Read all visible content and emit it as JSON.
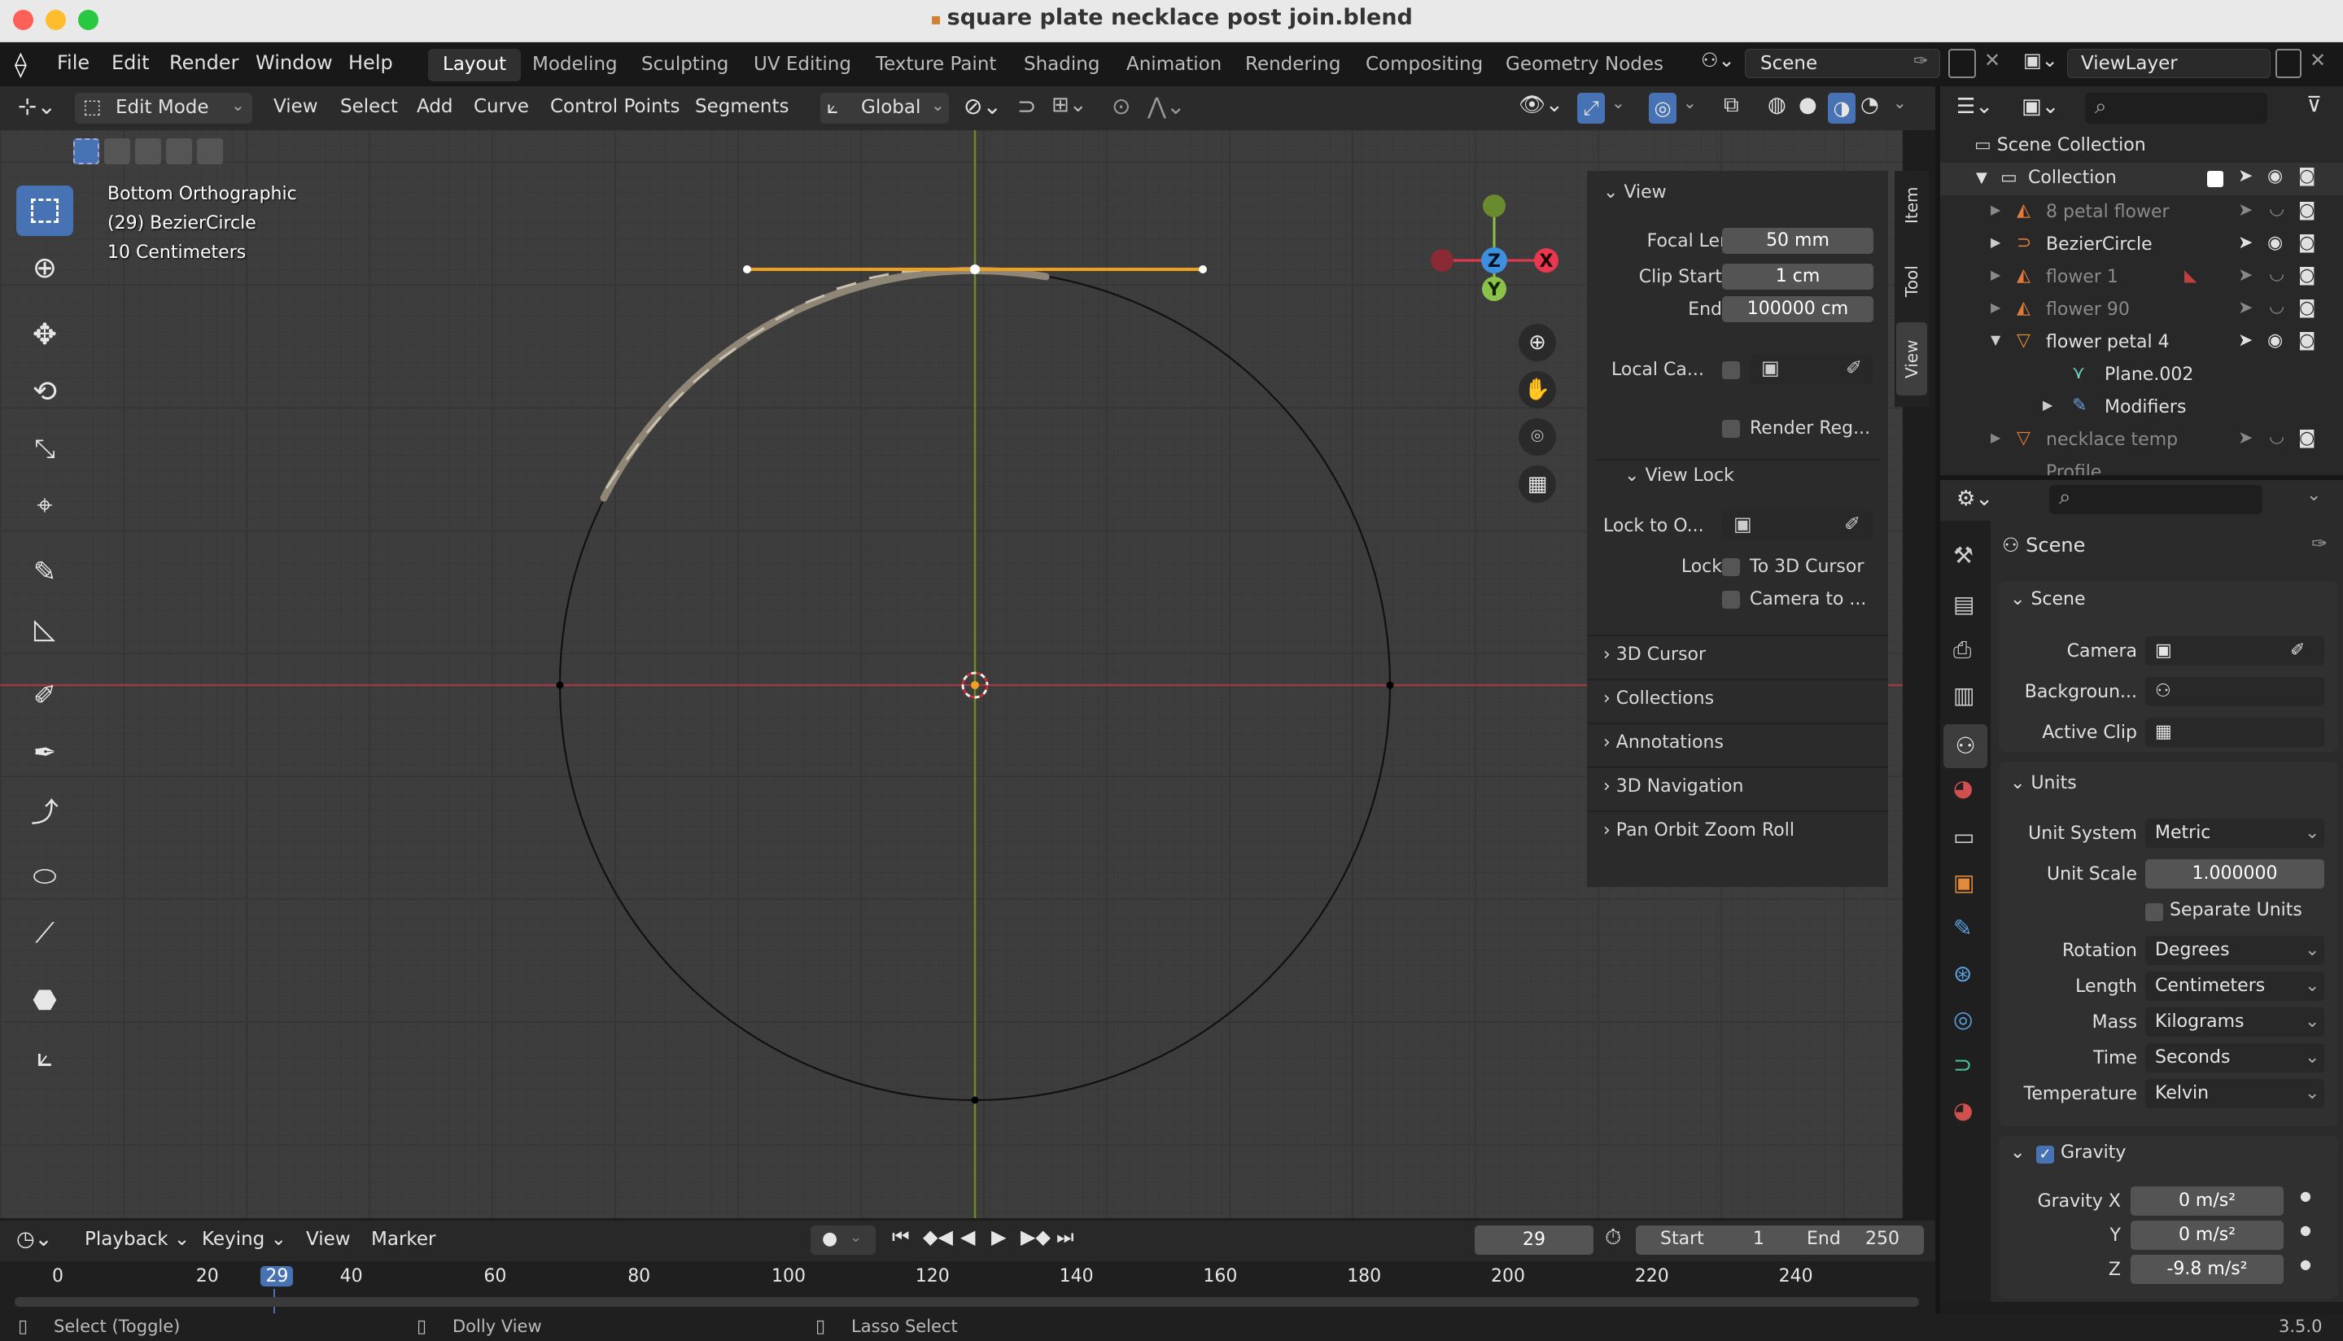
{
  "window": {
    "title": "square plate necklace post join.blend"
  },
  "menu": {
    "items": [
      "File",
      "Edit",
      "Render",
      "Window",
      "Help"
    ]
  },
  "workspaces": [
    "Layout",
    "Modeling",
    "Sculpting",
    "UV Editing",
    "Texture Paint",
    "Shading",
    "Animation",
    "Rendering",
    "Compositing",
    "Geometry Nodes"
  ],
  "scene_field": "Scene",
  "viewlayer_field": "ViewLayer",
  "header3d": {
    "mode": "Edit Mode",
    "menus": [
      "View",
      "Select",
      "Add",
      "Curve",
      "Control Points",
      "Segments"
    ],
    "orientation": "Global"
  },
  "viewport": {
    "view_name": "Bottom Orthographic",
    "object_info": "(29) BezierCircle",
    "scale_info": "10 Centimeters"
  },
  "npanel": {
    "tabs": [
      "Item",
      "Tool",
      "View"
    ],
    "view_header": "View",
    "focal_label": "Focal Len...",
    "focal_value": "50 mm",
    "clip_start_label": "Clip Start",
    "clip_start_value": "1 cm",
    "clip_end_label": "End",
    "clip_end_value": "100000 cm",
    "local_cam_label": "Local Ca...",
    "render_region_label": "Render Reg...",
    "view_lock_header": "View Lock",
    "lock_obj_label": "Lock to O...",
    "lock_label": "Lock",
    "to_cursor_label": "To 3D Cursor",
    "camera_to_label": "Camera to ...",
    "collapsed": [
      "3D Cursor",
      "Collections",
      "Annotations",
      "3D Navigation",
      "Pan Orbit Zoom Roll"
    ]
  },
  "outliner": {
    "root": "Scene Collection",
    "collection": "Collection",
    "items": [
      "8 petal flower",
      "BezierCircle",
      "flower 1",
      "flower 90",
      "flower petal 4"
    ],
    "children": [
      "Plane.002",
      "Modifiers"
    ],
    "partial": [
      "necklace temp",
      "Profile"
    ]
  },
  "properties": {
    "context": "Scene",
    "scene_panel": "Scene",
    "camera_label": "Camera",
    "background_label": "Backgroun...",
    "active_clip_label": "Active Clip",
    "units_panel": "Units",
    "unit_system_label": "Unit System",
    "unit_system": "Metric",
    "unit_scale_label": "Unit Scale",
    "unit_scale": "1.000000",
    "separate_units": "Separate Units",
    "rotation_label": "Rotation",
    "rotation": "Degrees",
    "length_label": "Length",
    "length": "Centimeters",
    "mass_label": "Mass",
    "mass": "Kilograms",
    "time_label": "Time",
    "time": "Seconds",
    "temperature_label": "Temperature",
    "temperature": "Kelvin",
    "gravity_panel": "Gravity",
    "gravity_x_label": "Gravity X",
    "gravity_x": "0 m/s²",
    "gravity_y_label": "Y",
    "gravity_y": "0 m/s²",
    "gravity_z_label": "Z",
    "gravity_z": "-9.8 m/s²"
  },
  "timeline": {
    "menus": [
      "Playback",
      "Keying",
      "View",
      "Marker"
    ],
    "current_frame": "29",
    "start_label": "Start",
    "start": "1",
    "end_label": "End",
    "end": "250",
    "ruler": [
      "0",
      "20",
      "29",
      "40",
      "60",
      "80",
      "100",
      "120",
      "140",
      "160",
      "180",
      "200",
      "220",
      "240"
    ]
  },
  "status": {
    "select": "Select (Toggle)",
    "dolly": "Dolly View",
    "lasso": "Lasso Select",
    "version": "3.5.0"
  },
  "gizmo": {
    "x": "X",
    "y": "Y",
    "z": "Z"
  },
  "colors": {
    "accent": "#4772b3",
    "x_axis": "#e8384f",
    "y_axis": "#8bc34a",
    "z_axis": "#3d8fe0",
    "selection": "#f0a020"
  }
}
